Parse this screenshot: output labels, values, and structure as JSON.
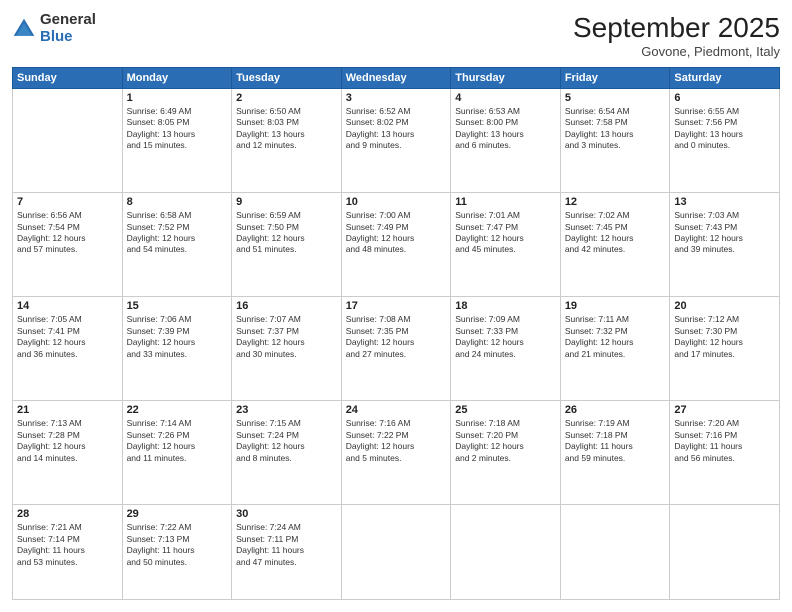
{
  "header": {
    "logo_general": "General",
    "logo_blue": "Blue",
    "month_title": "September 2025",
    "subtitle": "Govone, Piedmont, Italy"
  },
  "days_of_week": [
    "Sunday",
    "Monday",
    "Tuesday",
    "Wednesday",
    "Thursday",
    "Friday",
    "Saturday"
  ],
  "weeks": [
    [
      {
        "day": "",
        "info": ""
      },
      {
        "day": "1",
        "info": "Sunrise: 6:49 AM\nSunset: 8:05 PM\nDaylight: 13 hours\nand 15 minutes."
      },
      {
        "day": "2",
        "info": "Sunrise: 6:50 AM\nSunset: 8:03 PM\nDaylight: 13 hours\nand 12 minutes."
      },
      {
        "day": "3",
        "info": "Sunrise: 6:52 AM\nSunset: 8:02 PM\nDaylight: 13 hours\nand 9 minutes."
      },
      {
        "day": "4",
        "info": "Sunrise: 6:53 AM\nSunset: 8:00 PM\nDaylight: 13 hours\nand 6 minutes."
      },
      {
        "day": "5",
        "info": "Sunrise: 6:54 AM\nSunset: 7:58 PM\nDaylight: 13 hours\nand 3 minutes."
      },
      {
        "day": "6",
        "info": "Sunrise: 6:55 AM\nSunset: 7:56 PM\nDaylight: 13 hours\nand 0 minutes."
      }
    ],
    [
      {
        "day": "7",
        "info": "Sunrise: 6:56 AM\nSunset: 7:54 PM\nDaylight: 12 hours\nand 57 minutes."
      },
      {
        "day": "8",
        "info": "Sunrise: 6:58 AM\nSunset: 7:52 PM\nDaylight: 12 hours\nand 54 minutes."
      },
      {
        "day": "9",
        "info": "Sunrise: 6:59 AM\nSunset: 7:50 PM\nDaylight: 12 hours\nand 51 minutes."
      },
      {
        "day": "10",
        "info": "Sunrise: 7:00 AM\nSunset: 7:49 PM\nDaylight: 12 hours\nand 48 minutes."
      },
      {
        "day": "11",
        "info": "Sunrise: 7:01 AM\nSunset: 7:47 PM\nDaylight: 12 hours\nand 45 minutes."
      },
      {
        "day": "12",
        "info": "Sunrise: 7:02 AM\nSunset: 7:45 PM\nDaylight: 12 hours\nand 42 minutes."
      },
      {
        "day": "13",
        "info": "Sunrise: 7:03 AM\nSunset: 7:43 PM\nDaylight: 12 hours\nand 39 minutes."
      }
    ],
    [
      {
        "day": "14",
        "info": "Sunrise: 7:05 AM\nSunset: 7:41 PM\nDaylight: 12 hours\nand 36 minutes."
      },
      {
        "day": "15",
        "info": "Sunrise: 7:06 AM\nSunset: 7:39 PM\nDaylight: 12 hours\nand 33 minutes."
      },
      {
        "day": "16",
        "info": "Sunrise: 7:07 AM\nSunset: 7:37 PM\nDaylight: 12 hours\nand 30 minutes."
      },
      {
        "day": "17",
        "info": "Sunrise: 7:08 AM\nSunset: 7:35 PM\nDaylight: 12 hours\nand 27 minutes."
      },
      {
        "day": "18",
        "info": "Sunrise: 7:09 AM\nSunset: 7:33 PM\nDaylight: 12 hours\nand 24 minutes."
      },
      {
        "day": "19",
        "info": "Sunrise: 7:11 AM\nSunset: 7:32 PM\nDaylight: 12 hours\nand 21 minutes."
      },
      {
        "day": "20",
        "info": "Sunrise: 7:12 AM\nSunset: 7:30 PM\nDaylight: 12 hours\nand 17 minutes."
      }
    ],
    [
      {
        "day": "21",
        "info": "Sunrise: 7:13 AM\nSunset: 7:28 PM\nDaylight: 12 hours\nand 14 minutes."
      },
      {
        "day": "22",
        "info": "Sunrise: 7:14 AM\nSunset: 7:26 PM\nDaylight: 12 hours\nand 11 minutes."
      },
      {
        "day": "23",
        "info": "Sunrise: 7:15 AM\nSunset: 7:24 PM\nDaylight: 12 hours\nand 8 minutes."
      },
      {
        "day": "24",
        "info": "Sunrise: 7:16 AM\nSunset: 7:22 PM\nDaylight: 12 hours\nand 5 minutes."
      },
      {
        "day": "25",
        "info": "Sunrise: 7:18 AM\nSunset: 7:20 PM\nDaylight: 12 hours\nand 2 minutes."
      },
      {
        "day": "26",
        "info": "Sunrise: 7:19 AM\nSunset: 7:18 PM\nDaylight: 11 hours\nand 59 minutes."
      },
      {
        "day": "27",
        "info": "Sunrise: 7:20 AM\nSunset: 7:16 PM\nDaylight: 11 hours\nand 56 minutes."
      }
    ],
    [
      {
        "day": "28",
        "info": "Sunrise: 7:21 AM\nSunset: 7:14 PM\nDaylight: 11 hours\nand 53 minutes."
      },
      {
        "day": "29",
        "info": "Sunrise: 7:22 AM\nSunset: 7:13 PM\nDaylight: 11 hours\nand 50 minutes."
      },
      {
        "day": "30",
        "info": "Sunrise: 7:24 AM\nSunset: 7:11 PM\nDaylight: 11 hours\nand 47 minutes."
      },
      {
        "day": "",
        "info": ""
      },
      {
        "day": "",
        "info": ""
      },
      {
        "day": "",
        "info": ""
      },
      {
        "day": "",
        "info": ""
      }
    ]
  ]
}
